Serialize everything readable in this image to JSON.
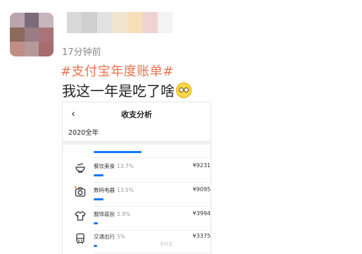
{
  "post": {
    "time": "17分钟前",
    "hashtag": "#支付宝年度账单#",
    "caption": "我这一年是吃了啥",
    "emoji": "flushed-face-emoji"
  },
  "screenshot": {
    "nav": {
      "back_icon": "chevron-left-icon",
      "title": "收支分析"
    },
    "year_label": "2020全年",
    "categories": [
      {
        "icon": "bowl-icon",
        "name": "餐饮美食",
        "percent": "13.7%",
        "amount": "¥9231",
        "share": 0.137
      },
      {
        "icon": "camera-icon",
        "name": "数码电器",
        "percent": "13.5%",
        "amount": "¥9095",
        "share": 0.135
      },
      {
        "icon": "shirt-icon",
        "name": "服饰装扮",
        "percent": "5.9%",
        "amount": "¥3994",
        "share": 0.059
      },
      {
        "icon": "bus-icon",
        "name": "交通出行",
        "percent": "5%",
        "amount": "¥3375",
        "share": 0.05
      }
    ]
  },
  "colors": {
    "hashtag": "#eb7350",
    "bar": "#1677ff"
  }
}
